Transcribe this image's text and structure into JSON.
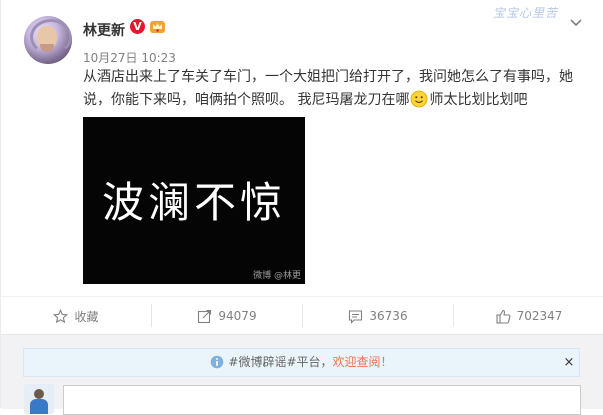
{
  "post": {
    "username": "林更新",
    "verified_badge": "V",
    "timestamp": "10月27日 10:23",
    "text_before_emoji": "从酒店出来上了车关了车门，一个大姐把门给打开了，我问她怎么了有事吗，她说，你能下来吗，咱俩拍个照呗。  我尼玛屠龙刀在哪",
    "emoji": "smile-emoji",
    "text_after_emoji": "师太比划比划吧",
    "image": {
      "text": "波澜不惊",
      "watermark": "微博 @林更"
    }
  },
  "header_watermark": "宝宝心里苦",
  "actions": {
    "favorite_label": "收藏",
    "repost_count": "94079",
    "comment_count": "36736",
    "like_count": "702347"
  },
  "notice": {
    "prefix": "#微博辟谣#平台，",
    "link_text": "欢迎查阅！",
    "close_label": "×"
  },
  "colors": {
    "accent": "#eb7350",
    "verified": "#e6162d",
    "notice_bg": "#eaf4fb"
  }
}
